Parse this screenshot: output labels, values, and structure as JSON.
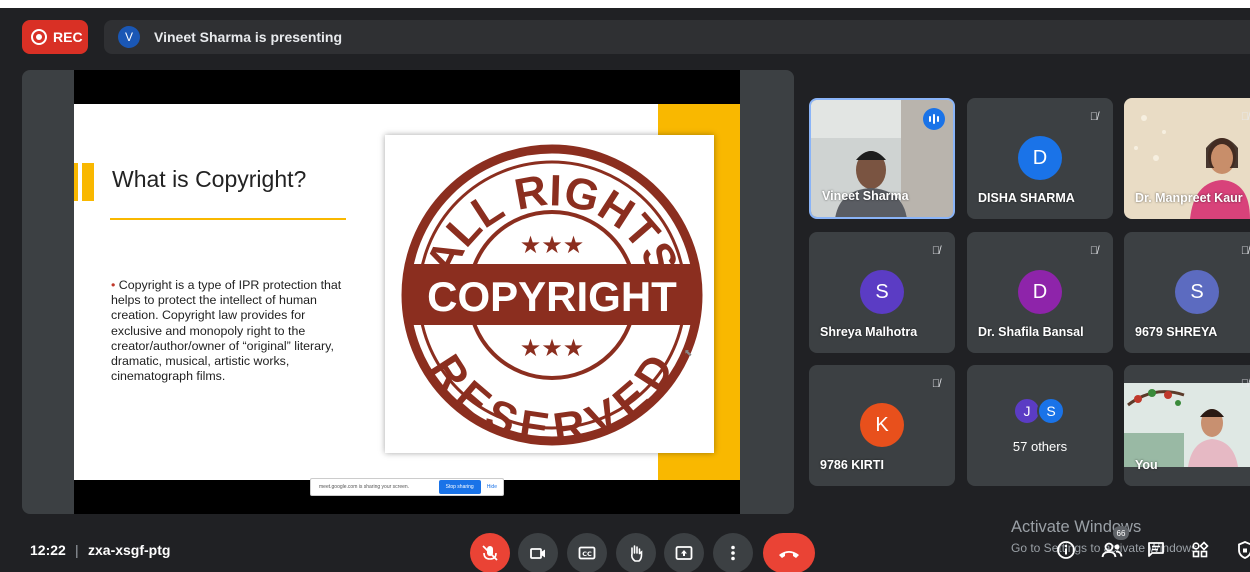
{
  "recording": {
    "label": "REC"
  },
  "presenter": {
    "initial": "V",
    "text": "Vineet Sharma is presenting"
  },
  "slide": {
    "title": "What is Copyright?",
    "bullet_marker": "•",
    "bullet": "Copyright is a type of IPR protection that helps to protect the intellect of human creation. Copyright law provides for exclusive and monopoly right to the creator/author/owner of “original” literary, dramatic, musical, artistic works, cinematograph films.",
    "stamp": {
      "top": "ALL RIGHTS",
      "center": "COPYRIGHT",
      "bottom": "RESERVED",
      "stars": "★★★"
    }
  },
  "share_bar": {
    "text": "meet.google.com is sharing your screen.",
    "stop_label": "Stop sharing",
    "hide_label": "Hide"
  },
  "participants": [
    {
      "name": "Vineet Sharma",
      "type": "video",
      "speaking": true
    },
    {
      "name": "DISHA SHARMA",
      "initial": "D",
      "color": "#1a73e8",
      "muted": true
    },
    {
      "name": "Dr. Manpreet Kaur",
      "type": "video",
      "muted": true
    },
    {
      "name": "Shreya Malhotra",
      "initial": "S",
      "color": "#5b3cc4",
      "muted": true
    },
    {
      "name": "Dr. Shafila Bansal",
      "initial": "D",
      "color": "#8e24aa",
      "muted": true
    },
    {
      "name": "9679 SHREYA",
      "initial": "S",
      "color": "#5c6bc0",
      "muted": true
    },
    {
      "name": "9786 KIRTI",
      "initial": "K",
      "color": "#e8501c",
      "muted": true
    },
    {
      "name": "You",
      "type": "video",
      "muted": true
    }
  ],
  "others": {
    "initials": [
      "J",
      "S"
    ],
    "colors": [
      "#5b3cc4",
      "#1a73e8"
    ],
    "label": "57 others"
  },
  "bottom_bar": {
    "time": "12:22",
    "separator": "|",
    "meeting_code": "zxa-xsgf-ptg",
    "people_count": "66"
  },
  "watermark": {
    "line1": "Activate Windows",
    "line2": "Go to Settings to activate Windows."
  },
  "icons": [
    "record-icon",
    "mic-off-icon",
    "camera-icon",
    "captions-icon",
    "raise-hand-icon",
    "present-icon",
    "more-icon",
    "end-call-icon",
    "info-icon",
    "people-icon",
    "chat-icon",
    "activities-icon",
    "host-controls-icon"
  ]
}
